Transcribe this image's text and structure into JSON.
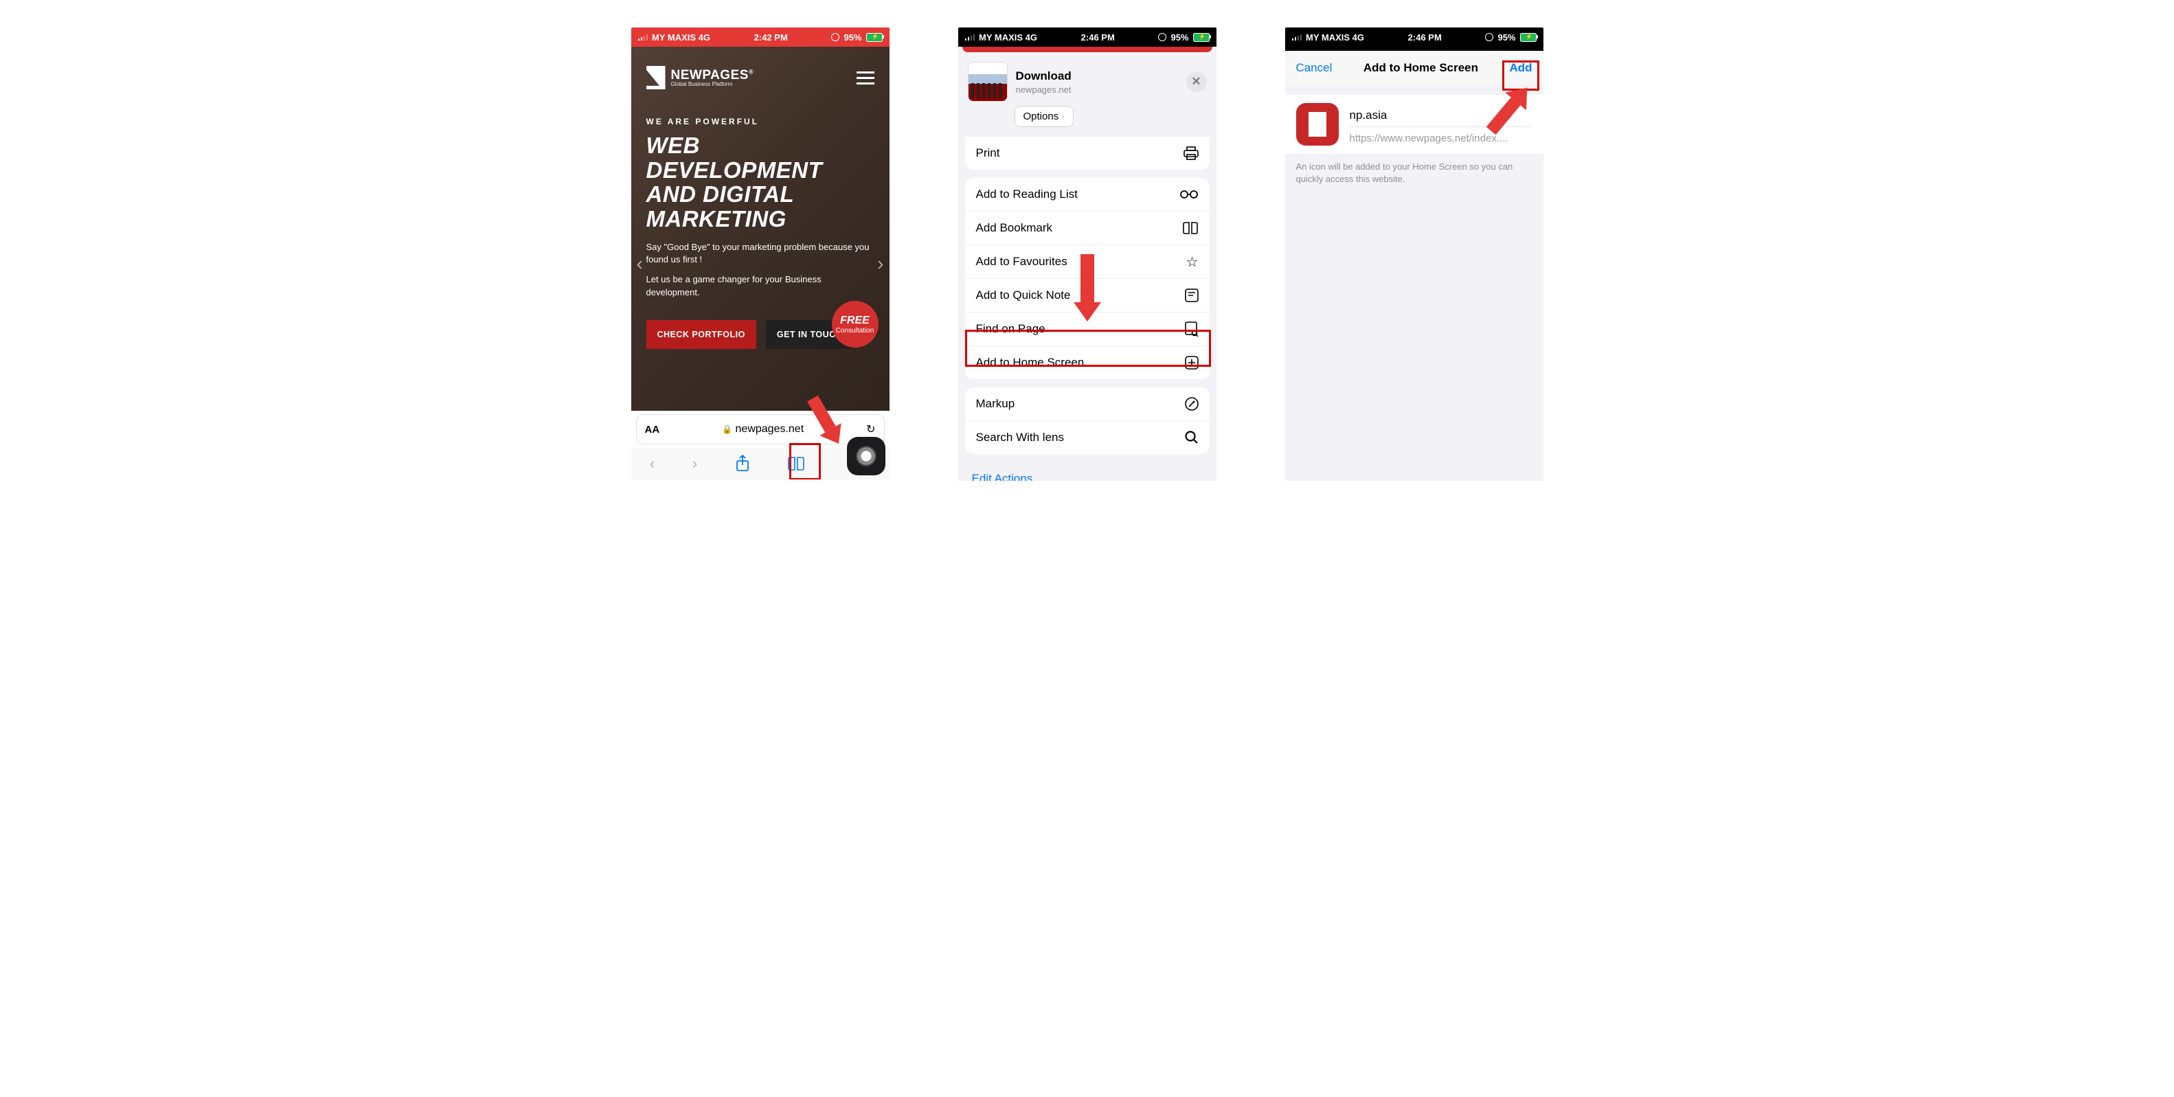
{
  "status1": {
    "carrier": "MY MAXIS  4G",
    "time": "2:42 PM",
    "battery": "95%"
  },
  "status2": {
    "carrier": "MY MAXIS  4G",
    "time": "2:46 PM",
    "battery": "95%"
  },
  "status3": {
    "carrier": "MY MAXIS  4G",
    "time": "2:46 PM",
    "battery": "95%"
  },
  "p1": {
    "brand": "NEWPAGES",
    "brand_reg": "®",
    "tagline": "Global Business Platform",
    "kicker": "WE ARE POWERFUL",
    "headline": "WEB DEVELOPMENT AND DIGITAL MARKETING",
    "copy1": "Say \"Good Bye\" to your marketing problem because you found us first !",
    "copy2": "Let us be a game changer for your Business development.",
    "free": "FREE",
    "free_sub": "Consultation",
    "btn1": "CHECK PORTFOLIO",
    "btn2": "GET IN TOUCH",
    "url": "newpages.net",
    "aa": "AA"
  },
  "p2": {
    "title": "Download",
    "subtitle": "newpages.net",
    "options": "Options",
    "rows": {
      "print": "Print",
      "reading": "Add to Reading List",
      "bookmark": "Add Bookmark",
      "fav": "Add to Favourites",
      "quick": "Add to Quick Note",
      "find": "Find on Page",
      "home": "Add to Home Screen",
      "markup": "Markup",
      "lens": "Search With lens"
    },
    "edit": "Edit Actions…"
  },
  "p3": {
    "cancel": "Cancel",
    "title": "Add to Home Screen",
    "add": "Add",
    "name": "np.asia",
    "url": "https://www.newpages.net/index....",
    "hint": "An icon will be added to your Home Screen so you can quickly access this website."
  }
}
